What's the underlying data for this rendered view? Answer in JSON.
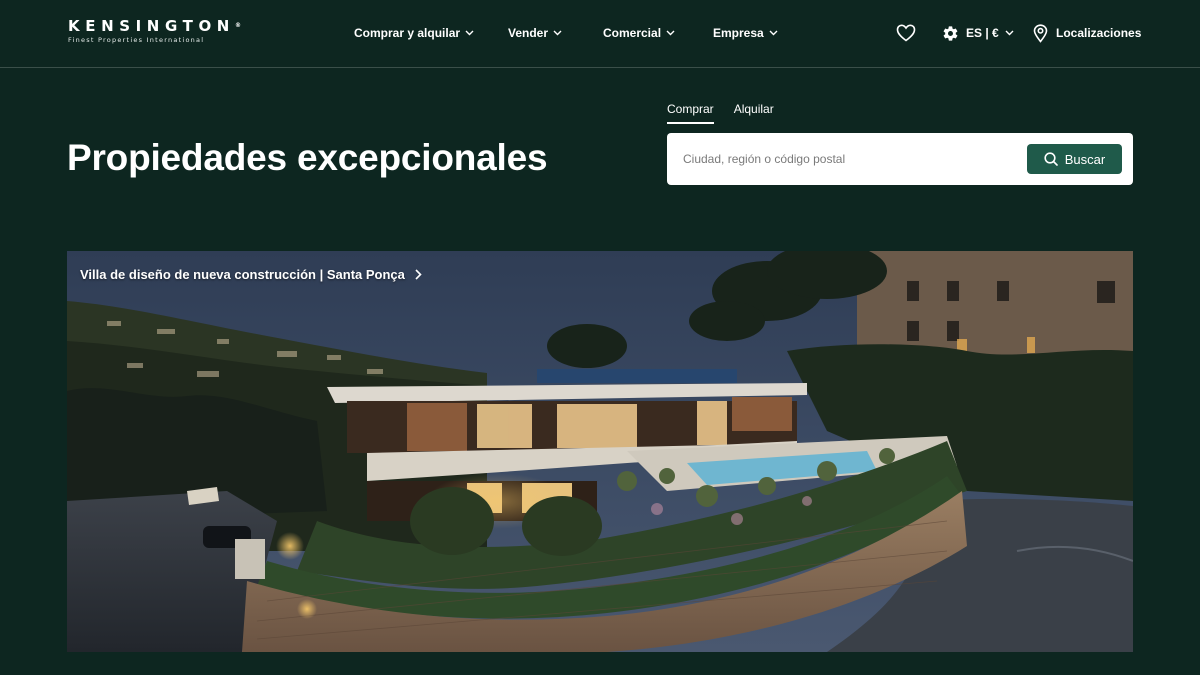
{
  "header": {
    "logo": {
      "name": "KENSINGTON",
      "mark": "®",
      "tagline": "Finest Properties International"
    },
    "nav": [
      {
        "label": "Comprar y alquilar"
      },
      {
        "label": "Vender"
      },
      {
        "label": "Comercial"
      },
      {
        "label": "Empresa"
      }
    ],
    "language_currency": "ES | €",
    "locations_label": "Localizaciones"
  },
  "hero": {
    "title_light": "Propiedades",
    "title_bold": "excepcionales"
  },
  "search": {
    "tabs": [
      {
        "label": "Comprar",
        "active": true
      },
      {
        "label": "Alquilar",
        "active": false
      }
    ],
    "placeholder": "Ciudad, región o código postal",
    "button_label": "Buscar"
  },
  "featured": {
    "caption": "Villa de diseño de nueva construcción | Santa Ponça"
  },
  "icons": {
    "favorites": "heart-icon",
    "settings": "gear-icon",
    "location": "map-pin-icon",
    "search": "search-icon",
    "dropdown": "chevron-down-icon",
    "next": "chevron-right-icon"
  },
  "colors": {
    "background": "#0d2620",
    "accent_button": "#1f5a4a",
    "text": "#ffffff"
  }
}
